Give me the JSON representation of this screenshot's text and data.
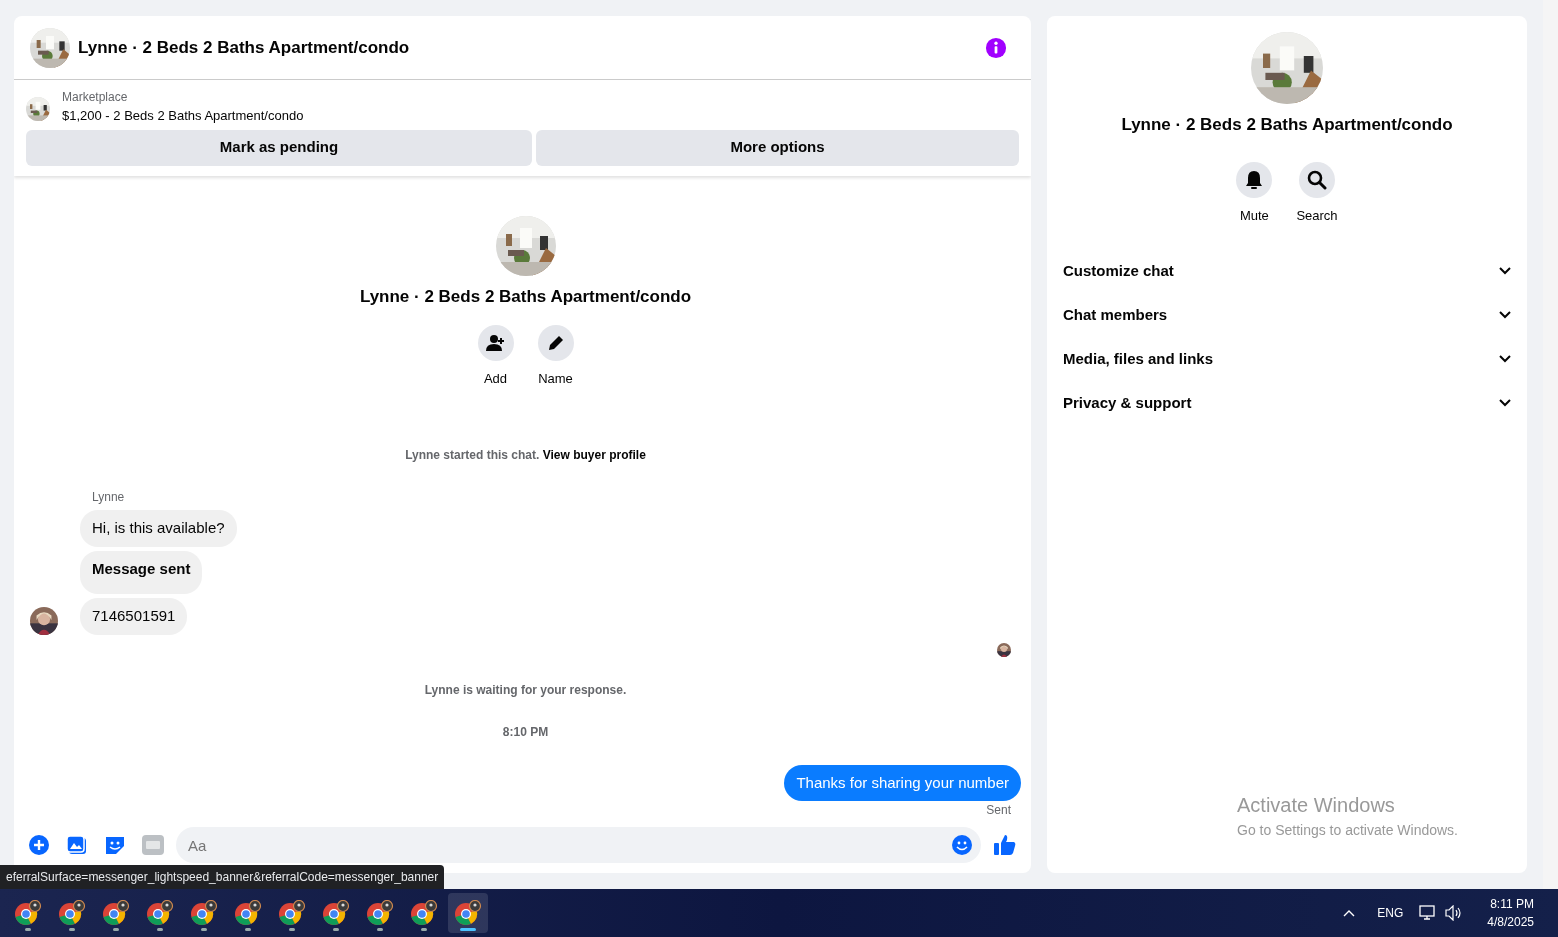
{
  "header": {
    "title": "Lynne · 2 Beds 2 Baths Apartment/condo"
  },
  "listing": {
    "source": "Marketplace",
    "summary": "$1,200 - 2 Beds 2 Baths Apartment/condo",
    "buttons": [
      "Mark as pending",
      "More options"
    ]
  },
  "intro": {
    "title": "Lynne · 2 Beds 2 Baths Apartment/condo",
    "actions": [
      {
        "label": "Add",
        "kind": "add"
      },
      {
        "label": "Name",
        "kind": "edit"
      }
    ]
  },
  "thread": {
    "note": "Lynne started this chat.",
    "note_link": "View buyer profile",
    "sender": "Lynne",
    "incoming": [
      {
        "text": "Hi, is this available?",
        "bold": false
      },
      {
        "text": "Message sent",
        "bold": true
      },
      {
        "text": "7146501591",
        "bold": false
      }
    ],
    "waiting": "Lynne is waiting for your response.",
    "time": "8:10 PM",
    "outgoing": {
      "text": "Thanks for sharing your number",
      "status": "Sent"
    }
  },
  "composer": {
    "placeholder": "Aa"
  },
  "details": {
    "title": "Lynne · 2 Beds 2 Baths Apartment/condo",
    "actions": [
      {
        "label": "Mute",
        "kind": "mute"
      },
      {
        "label": "Search",
        "kind": "search"
      }
    ],
    "sections": [
      {
        "label": "Customize chat",
        "expanded": false
      },
      {
        "label": "Chat members",
        "expanded": false
      },
      {
        "label": "Media, files and links",
        "expanded": false
      },
      {
        "label": "Privacy & support",
        "expanded": false
      }
    ]
  },
  "activation": {
    "title": "Activate Windows",
    "subtitle": "Go to Settings to activate Windows."
  },
  "status_url": "eferralSurface=messenger_lightspeed_banner&referralCode=messenger_banner",
  "taskbar": {
    "apps": [
      {
        "selected": false
      },
      {
        "selected": false
      },
      {
        "selected": false
      },
      {
        "selected": false
      },
      {
        "selected": false
      },
      {
        "selected": false
      },
      {
        "selected": false
      },
      {
        "selected": false
      },
      {
        "selected": false
      },
      {
        "selected": false
      },
      {
        "selected": true
      }
    ]
  },
  "tray": {
    "language": "ENG",
    "time": "8:11 PM",
    "date": "4/8/2025"
  }
}
